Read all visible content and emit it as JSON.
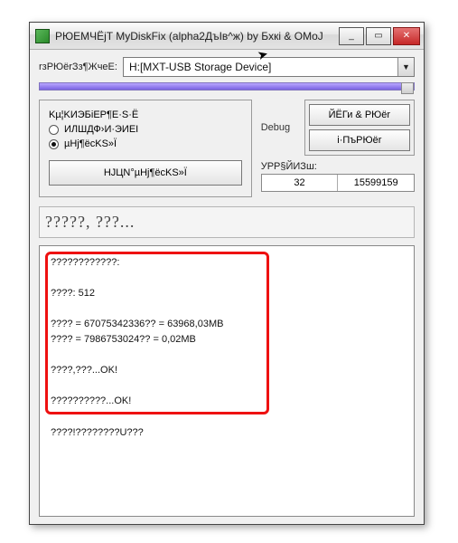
{
  "window": {
    "title": "РЮEMЧЁjT MyDiskFix (alpha2ДъIв^ж) by Бxкi & OMoJ"
  },
  "drive": {
    "label": "rзPЮёrЗз¶ЖчеE:",
    "value": "H:[MXT-USB Storage Device]"
  },
  "group": {
    "legend": "Kµ¦KИЭБiEP¶E·S·Ё",
    "opt1": "ИЛШДФ›И·ЭИEI",
    "opt2": "µHj¶ёcKS»Ї",
    "button": "HJЦN°µHj¶ёcKS»Ї"
  },
  "debug": {
    "label": "Debug",
    "btn1": "ЙЁГи & PЮёr",
    "btn2": "i·ПъPЮёr"
  },
  "stats": {
    "label": "УРР§ЙИЗш:",
    "v1": "32",
    "v2": "15599159"
  },
  "status": {
    "text": "?????, ???..."
  },
  "output": {
    "text": "????????????:\n\n????: 512\n\n???? = 67075342336?? = 63968,03MB\n???? = 7986753024?? = 0,02MB\n\n????,???...OK!\n\n??????????...OK!\n\n????!????????U???"
  },
  "winbtns": {
    "min": "_",
    "max": "▭",
    "close": "✕"
  }
}
